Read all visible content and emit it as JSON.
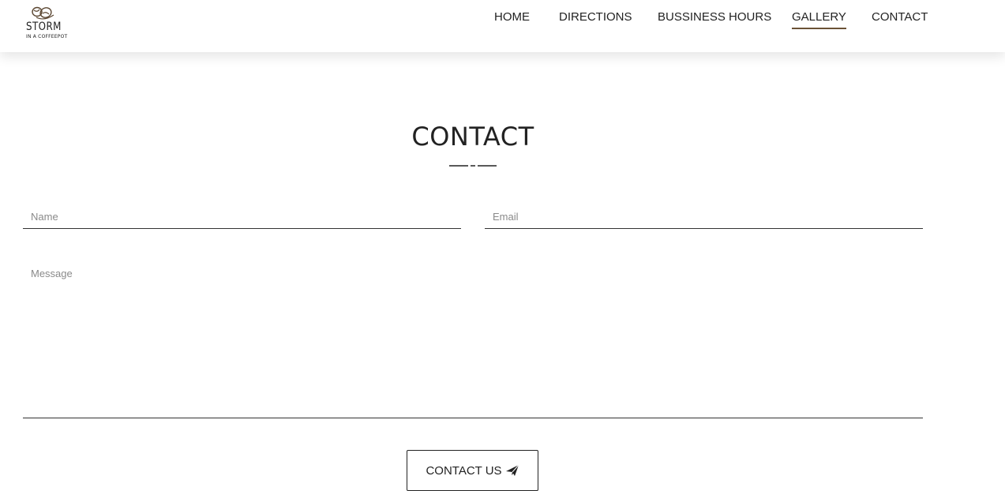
{
  "brand": {
    "logo_word": "STORM",
    "logo_sub": "IN A COFFEEPOT"
  },
  "nav": {
    "items": [
      {
        "label": "HOME",
        "active": false
      },
      {
        "label": "DIRECTIONS",
        "active": false
      },
      {
        "label": "BUSSINESS HOURS",
        "active": false
      },
      {
        "label": "GALLERY",
        "active": true
      },
      {
        "label": "CONTACT",
        "active": false
      }
    ]
  },
  "contact": {
    "title": "CONTACT",
    "name_placeholder": "Name",
    "email_placeholder": "Email",
    "message_placeholder": "Message",
    "submit_label": "CONTACT US"
  },
  "colors": {
    "accent": "#6b5236",
    "text": "#222222",
    "placeholder": "#8a8a8a"
  },
  "icons": {
    "logo": "coffee-beans-logo-icon",
    "submit": "paper-plane-icon"
  }
}
